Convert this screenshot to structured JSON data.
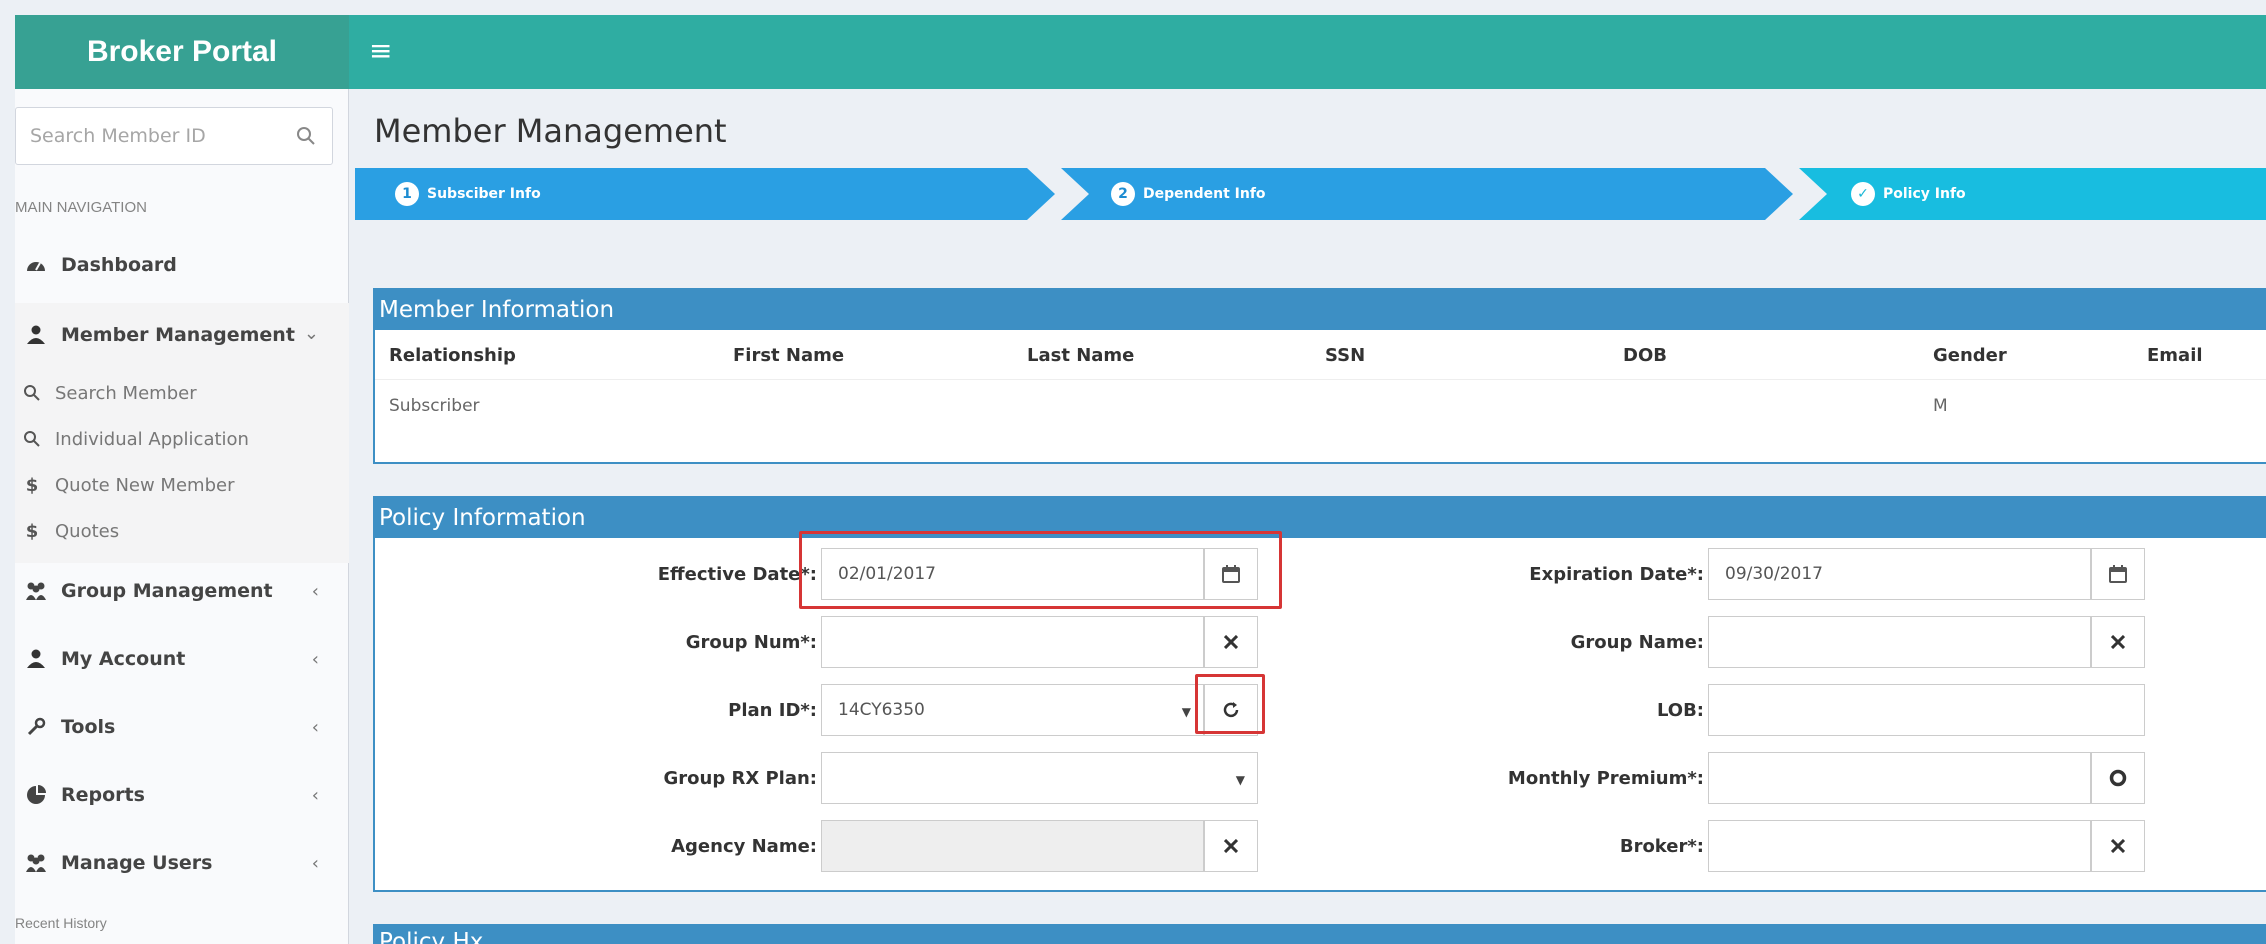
{
  "brand": {
    "title": "Broker Portal"
  },
  "sidebar": {
    "search_placeholder": "Search Member ID",
    "nav_header": "MAIN NAVIGATION",
    "items": [
      {
        "label": "Dashboard",
        "icon": "dashboard-icon"
      },
      {
        "label": "Member Management",
        "icon": "user-icon"
      },
      {
        "label": "Group Management",
        "icon": "users-icon"
      },
      {
        "label": "My Account",
        "icon": "user-icon"
      },
      {
        "label": "Tools",
        "icon": "wrench-icon"
      },
      {
        "label": "Reports",
        "icon": "pie-chart-icon"
      },
      {
        "label": "Manage Users",
        "icon": "users-icon"
      }
    ],
    "submenu": [
      {
        "label": "Search Member",
        "icon": "search-icon"
      },
      {
        "label": "Individual Application",
        "icon": "search-icon"
      },
      {
        "label": "Quote New Member",
        "icon": "dollar-icon"
      },
      {
        "label": "Quotes",
        "icon": "dollar-icon"
      }
    ],
    "recent_history": "Recent History"
  },
  "page": {
    "title": "Member Management"
  },
  "wizard": {
    "steps": [
      {
        "number": "1",
        "label": "Subsciber Info"
      },
      {
        "number": "2",
        "label": "Dependent Info"
      },
      {
        "number": "✓",
        "label": "Policy Info"
      }
    ]
  },
  "member_info": {
    "title": "Member Information",
    "columns": [
      "Relationship",
      "First Name",
      "Last Name",
      "SSN",
      "DOB",
      "Gender",
      "Email"
    ],
    "row": [
      "Subscriber",
      "",
      "",
      "",
      "",
      "M",
      ""
    ]
  },
  "policy_info": {
    "title": "Policy Information",
    "effective_date": {
      "label": "Effective Date*:",
      "value": "02/01/2017"
    },
    "group_num": {
      "label": "Group Num*:",
      "value": ""
    },
    "plan_id": {
      "label": "Plan ID*:",
      "value": "14CY6350"
    },
    "group_rx_plan": {
      "label": "Group RX Plan:",
      "value": ""
    },
    "agency_name": {
      "label": "Agency Name:",
      "value": ""
    },
    "expiration_date": {
      "label": "Expiration Date*:",
      "value": "09/30/2017"
    },
    "group_name": {
      "label": "Group Name:",
      "value": ""
    },
    "lob": {
      "label": "LOB:",
      "value": ""
    },
    "monthly_premium": {
      "label": "Monthly Premium*:",
      "value": ""
    },
    "broker": {
      "label": "Broker*:",
      "value": ""
    }
  },
  "policy_hx": {
    "title": "Policy Hx"
  },
  "colors": {
    "header_teal": "#2fada2",
    "brand_teal": "#37a193",
    "wizard_blue": "#2a9fe3",
    "wizard_active": "#18bde0",
    "panel_blue": "#3d8fc4",
    "highlight_red": "#d63535"
  }
}
